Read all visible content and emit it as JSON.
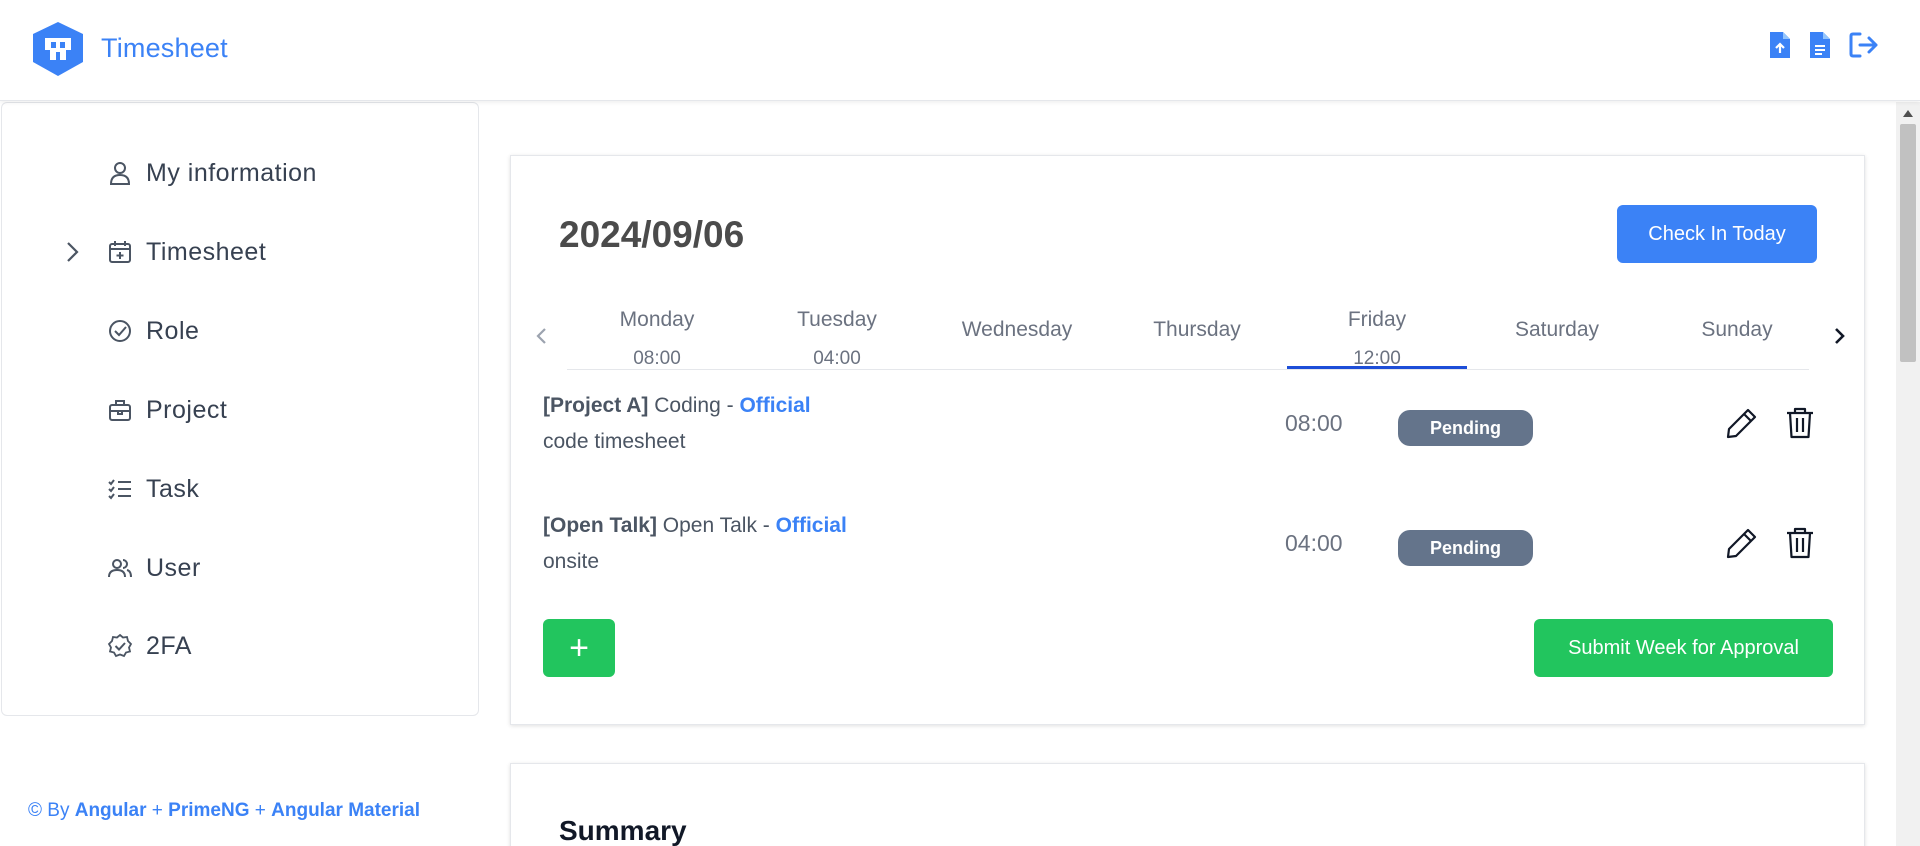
{
  "header": {
    "app_title": "Timesheet",
    "icons": [
      "file-upload-icon",
      "file-text-icon",
      "sign-out-icon"
    ]
  },
  "sidebar": {
    "items": [
      {
        "label": "My information",
        "icon": "user-icon"
      },
      {
        "label": "Timesheet",
        "icon": "calendar-plus-icon",
        "expandable": true
      },
      {
        "label": "Role",
        "icon": "check-circle-icon"
      },
      {
        "label": "Project",
        "icon": "briefcase-icon"
      },
      {
        "label": "Task",
        "icon": "list-check-icon"
      },
      {
        "label": "User",
        "icon": "users-icon"
      },
      {
        "label": "2FA",
        "icon": "verified-badge-icon"
      }
    ]
  },
  "footer": {
    "prefix": "© By ",
    "tech1": "Angular",
    "sep1": " + ",
    "tech2": "PrimeNG",
    "sep2": " + ",
    "tech3": "Angular Material"
  },
  "main": {
    "date": "2024/09/06",
    "check_in_label": "Check In Today",
    "week": [
      {
        "name": "Monday",
        "hours": "08:00"
      },
      {
        "name": "Tuesday",
        "hours": "04:00"
      },
      {
        "name": "Wednesday",
        "hours": ""
      },
      {
        "name": "Thursday",
        "hours": ""
      },
      {
        "name": "Friday",
        "hours": "12:00",
        "active": true
      },
      {
        "name": "Saturday",
        "hours": ""
      },
      {
        "name": "Sunday",
        "hours": ""
      }
    ],
    "entries": [
      {
        "project": "[Project A]",
        "task": " Coding - ",
        "type": "Official",
        "note": "code timesheet",
        "hours": "08:00",
        "status": "Pending"
      },
      {
        "project": "[Open Talk]",
        "task": " Open Talk - ",
        "type": "Official",
        "note": "onsite",
        "hours": "04:00",
        "status": "Pending"
      }
    ],
    "add_label": "+",
    "submit_label": "Submit Week for Approval"
  },
  "summary": {
    "title": "Summary"
  },
  "colors": {
    "primary": "#3b82f6",
    "success": "#22c55e",
    "badge": "#64748b"
  }
}
